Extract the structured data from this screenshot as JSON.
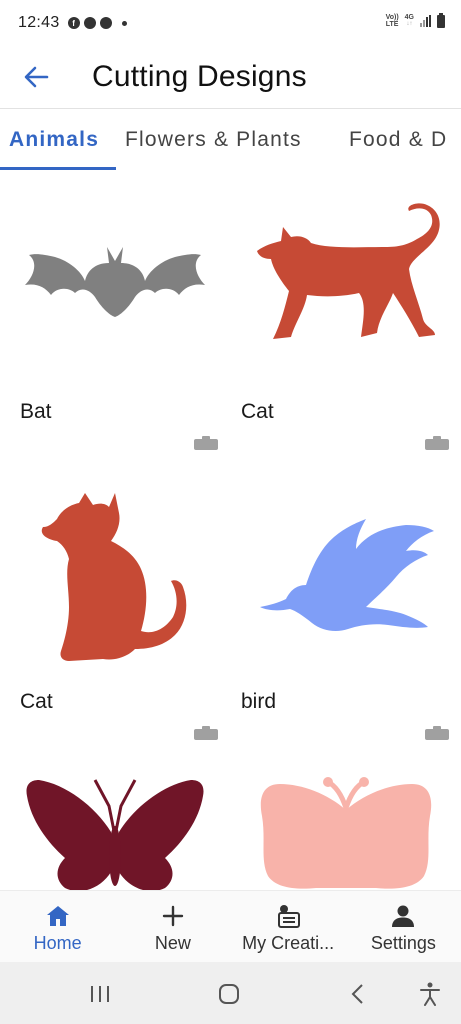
{
  "status_bar": {
    "time": "12:43",
    "network_top": "Vo))",
    "network_bottom": "LTE",
    "network_type": "4G",
    "icons": [
      "facebook-icon",
      "chrome-like-icon",
      "chrome-icon",
      "notification-dot-icon",
      "signal-icon",
      "battery-icon"
    ]
  },
  "app_bar": {
    "title": "Cutting Designs",
    "back_icon": "arrow-back-icon"
  },
  "tabs": [
    {
      "label": "Animals",
      "active": true
    },
    {
      "label": "Flowers & Plants",
      "active": false
    },
    {
      "label": "Food & D",
      "active": false
    }
  ],
  "designs": [
    {
      "label": "Bat",
      "color": "#808080",
      "icon": "bat-silhouette-icon"
    },
    {
      "label": "Cat",
      "color": "#c64a35",
      "icon": "walking-cat-silhouette-icon"
    },
    {
      "label": "Cat",
      "color": "#c64a35",
      "icon": "sitting-cat-silhouette-icon"
    },
    {
      "label": "bird",
      "color": "#7f9ef7",
      "icon": "bird-silhouette-icon"
    },
    {
      "label": "",
      "color": "#701528",
      "icon": "butterfly-silhouette-icon"
    },
    {
      "label": "",
      "color": "#f8b3aa",
      "icon": "butterfly-wings-silhouette-icon"
    }
  ],
  "bottom_nav": [
    {
      "label": "Home",
      "icon": "home-icon",
      "active": true
    },
    {
      "label": "New",
      "icon": "plus-icon",
      "active": false
    },
    {
      "label": "My Creati...",
      "icon": "creations-icon",
      "active": false
    },
    {
      "label": "Settings",
      "icon": "person-icon",
      "active": false
    }
  ],
  "colors": {
    "accent": "#3366c4",
    "text": "#1a1a1a",
    "badge": "#a0a0a0"
  }
}
